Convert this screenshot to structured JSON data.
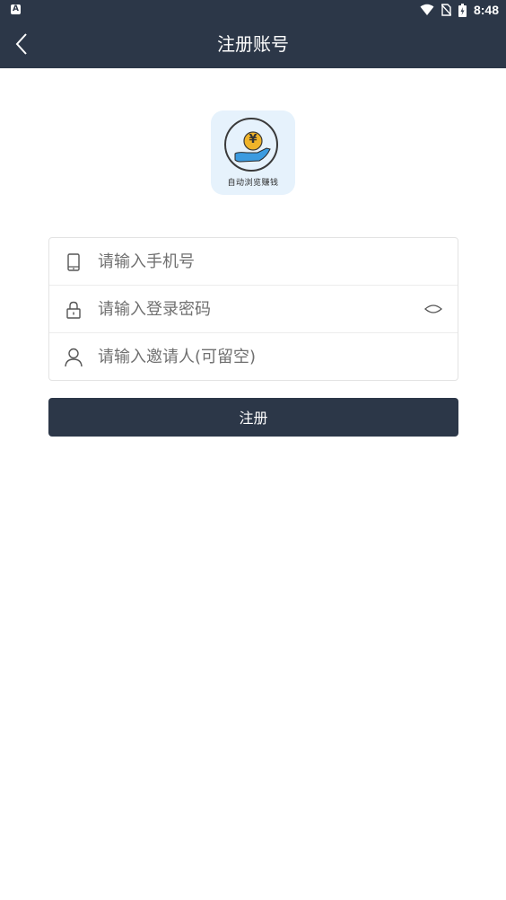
{
  "status_bar": {
    "left_icon": "A",
    "time": "8:48"
  },
  "app_bar": {
    "title": "注册账号"
  },
  "logo": {
    "caption": "自动浏览赚钱",
    "symbol": "¥"
  },
  "form": {
    "phone_placeholder": "请输入手机号",
    "password_placeholder": "请输入登录密码",
    "invite_placeholder": "请输入邀请人(可留空)"
  },
  "submit_label": "注册",
  "colors": {
    "primary": "#2c3748",
    "logo_bg": "#e6f2fc",
    "hand": "#3b9be0",
    "coin": "#f0b429"
  }
}
